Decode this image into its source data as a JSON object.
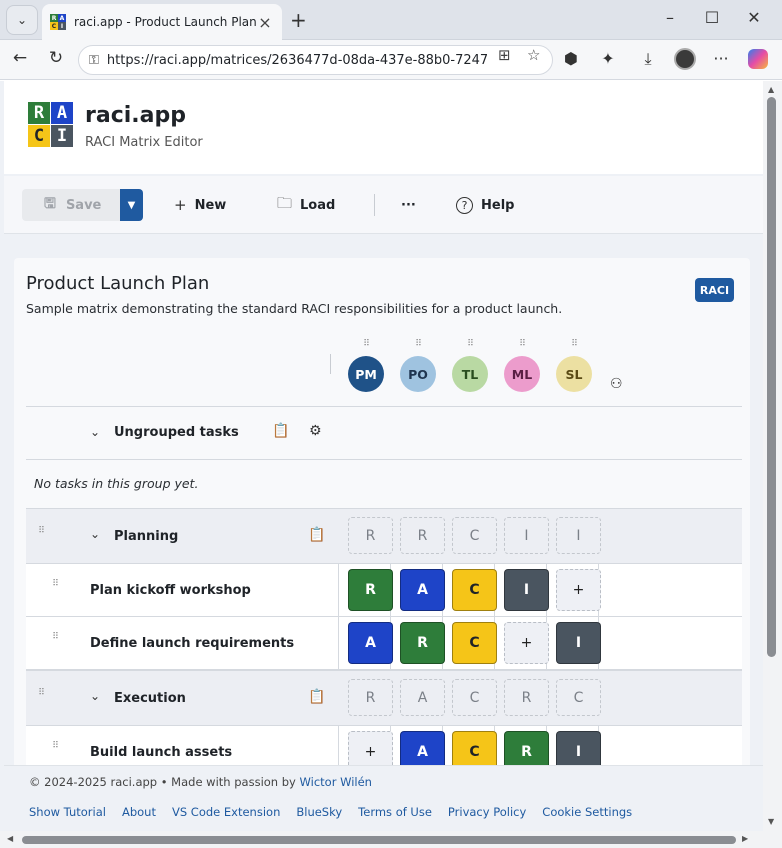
{
  "browser": {
    "tab_title": "raci.app - Product Launch Plan",
    "url": "https://raci.app/matrices/2636477d-08da-437e-88b0-7247..."
  },
  "app": {
    "logo_letters": [
      "R",
      "A",
      "C",
      "I"
    ],
    "logo_colors": [
      "#2e7d3a",
      "#1e44c8",
      "#f5c518",
      "#4a5560"
    ],
    "name": "raci.app",
    "subtitle": "RACI Matrix Editor"
  },
  "toolbar": {
    "save_label": "Save",
    "new_label": "New",
    "load_label": "Load",
    "more_label": "···",
    "help_label": "Help"
  },
  "matrix": {
    "title": "Product Launch Plan",
    "description": "Sample matrix demonstrating the standard RACI responsibilities for a product launch.",
    "badge": "RACI",
    "people": [
      {
        "initials": "PM",
        "bg": "#1f5288",
        "fg": "#ffffff"
      },
      {
        "initials": "PO",
        "bg": "#9fc3e0",
        "fg": "#1f3550"
      },
      {
        "initials": "TL",
        "bg": "#b9d9a3",
        "fg": "#2a4d1f"
      },
      {
        "initials": "ML",
        "bg": "#ec9ccc",
        "fg": "#5a1f44"
      },
      {
        "initials": "SL",
        "bg": "#ece0a2",
        "fg": "#5a4a14"
      }
    ],
    "ungrouped_label": "Ungrouped tasks",
    "empty_note": "No tasks in this group yet.",
    "groups": [
      {
        "name": "Planning",
        "summary": [
          "R",
          "R",
          "C",
          "I",
          "I"
        ],
        "tasks": [
          {
            "name": "Plan kickoff workshop",
            "cells": [
              "R",
              "A",
              "C",
              "I",
              "+"
            ]
          },
          {
            "name": "Define launch requirements",
            "cells": [
              "A",
              "R",
              "C",
              "+",
              "I"
            ]
          }
        ]
      },
      {
        "name": "Execution",
        "summary": [
          "R",
          "A",
          "C",
          "R",
          "C"
        ],
        "tasks": [
          {
            "name": "Build launch assets",
            "cells": [
              "+",
              "A",
              "C",
              "R",
              "I"
            ]
          }
        ]
      }
    ]
  },
  "role_colors": {
    "R": {
      "bg": "#2e7d3a",
      "fg": "#ffffff"
    },
    "A": {
      "bg": "#1e44c8",
      "fg": "#ffffff"
    },
    "C": {
      "bg": "#f5c518",
      "fg": "#1f2328"
    },
    "I": {
      "bg": "#4a5560",
      "fg": "#ffffff"
    }
  },
  "footer": {
    "copyright_prefix": "© 2024-2025 raci.app • Made with passion by ",
    "author": "Wictor Wilén",
    "links": [
      "Show Tutorial",
      "About",
      "VS Code Extension",
      "BlueSky",
      "Terms of Use",
      "Privacy Policy",
      "Cookie Settings"
    ]
  }
}
